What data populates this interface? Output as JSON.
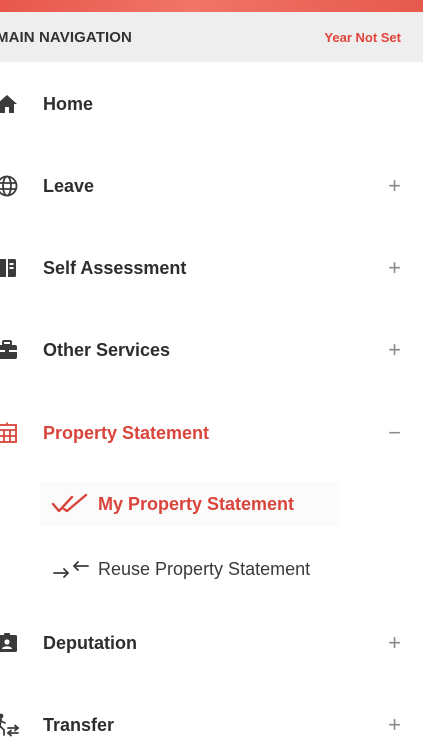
{
  "header": {
    "title": "MAIN NAVIGATION",
    "year_status": "Year Not Set"
  },
  "menu": {
    "items": [
      {
        "label": "Home",
        "icon": "home-icon",
        "toggle": ""
      },
      {
        "label": "Leave",
        "icon": "globe-icon",
        "toggle": "+"
      },
      {
        "label": "Self Assessment",
        "icon": "book-icon",
        "toggle": "+"
      },
      {
        "label": "Other Services",
        "icon": "briefcase-icon",
        "toggle": "+"
      },
      {
        "label": "Property Statement",
        "icon": "building-icon",
        "toggle": "−"
      },
      {
        "label": "Deputation",
        "icon": "id-card-icon",
        "toggle": "+"
      },
      {
        "label": "Transfer",
        "icon": "person-transfer-icon",
        "toggle": "+"
      }
    ],
    "subitems": [
      {
        "label": "My Property Statement",
        "icon": "double-check-icon"
      },
      {
        "label": "Reuse Property Statement",
        "icon": "exchange-arrows-icon"
      }
    ]
  },
  "colors": {
    "accent": "#d9443b",
    "header_bg": "#eeeeee",
    "text": "#2e2e2e",
    "icon": "#3b3b3b"
  }
}
